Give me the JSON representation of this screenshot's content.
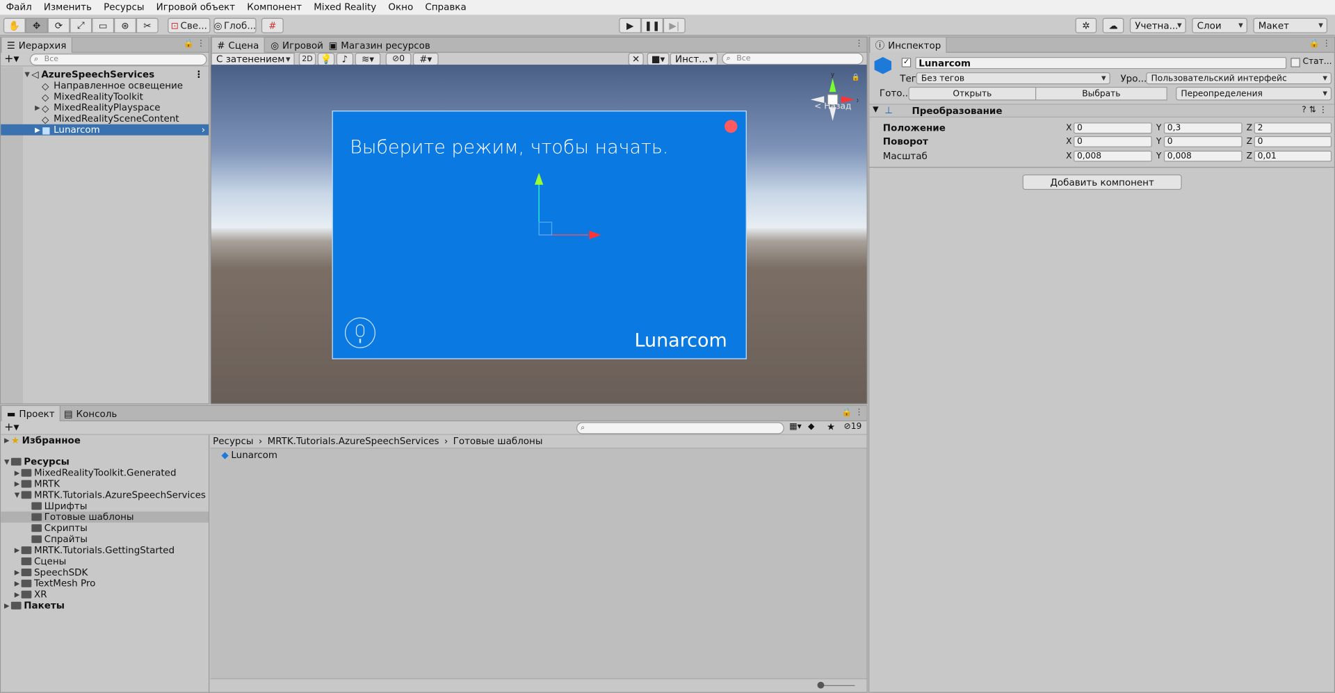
{
  "menu": [
    "Файл",
    "Изменить",
    "Ресурсы",
    "Игровой объект",
    "Компонент",
    "Mixed Reality",
    "Окно",
    "Справка"
  ],
  "toolbar": {
    "pivot_label": "Све...",
    "global_label": "Глоб...",
    "account_label": "Учетна...",
    "layers_label": "Слои",
    "layout_label": "Макет"
  },
  "hierarchy": {
    "tab": "Иерархия",
    "search_placeholder": "Все",
    "scene": "AzureSpeechServices",
    "items": [
      {
        "label": "Направленное освещение"
      },
      {
        "label": "MixedRealityToolkit"
      },
      {
        "label": "MixedRealityPlayspace"
      },
      {
        "label": "MixedRealitySceneContent"
      },
      {
        "label": "Lunarcom"
      }
    ]
  },
  "scene_view": {
    "tabs": [
      "Сцена",
      "Игровой",
      "Магазин ресурсов"
    ],
    "shading": "С затенением",
    "mode_2d": "2D",
    "hidden_count": "0",
    "tools_label": "Инст...",
    "search_placeholder": "Все",
    "back_label": "< Назад",
    "canvas_title": "Выберите режим, чтобы начать.",
    "canvas_brand": "Lunarcom"
  },
  "project": {
    "tabs": [
      "Проект",
      "Консоль"
    ],
    "hidden_count": "19",
    "tree": [
      {
        "label": "Избранное",
        "bold": true
      },
      {
        "label": "Ресурсы",
        "bold": true
      },
      {
        "label": "MixedRealityToolkit.Generated"
      },
      {
        "label": "MRTK"
      },
      {
        "label": "MRTK.Tutorials.AzureSpeechServices"
      },
      {
        "label": "Шрифты"
      },
      {
        "label": "Готовые шаблоны"
      },
      {
        "label": "Скрипты"
      },
      {
        "label": "Спрайты"
      },
      {
        "label": "MRTK.Tutorials.GettingStarted"
      },
      {
        "label": "Сцены"
      },
      {
        "label": "SpeechSDK"
      },
      {
        "label": "TextMesh Pro"
      },
      {
        "label": "XR"
      },
      {
        "label": "Пакеты",
        "bold": true
      }
    ],
    "breadcrumb": [
      "Ресурсы",
      "MRTK.Tutorials.AzureSpeechServices",
      "Готовые шаблоны"
    ],
    "asset": "Lunarcom"
  },
  "inspector": {
    "tab": "Инспектор",
    "object_name": "Lunarcom",
    "static_label": "Стат...",
    "tag_label": "Тег",
    "tag_value": "Без тегов",
    "layer_label": "Уро...",
    "layer_value": "Пользовательский интерфейс",
    "prefab_label": "Гото...",
    "open_btn": "Открыть",
    "select_btn": "Выбрать",
    "overrides_btn": "Переопределения",
    "transform_title": "Преобразование",
    "position_label": "Положение",
    "rotation_label": "Поворот",
    "scale_label": "Масштаб",
    "axes": [
      "X",
      "Y",
      "Z"
    ],
    "position": [
      "0",
      "0,3",
      "2"
    ],
    "rotation": [
      "0",
      "0",
      "0"
    ],
    "scale": [
      "0,008",
      "0,008",
      "0,01"
    ],
    "add_component": "Добавить компонент"
  }
}
